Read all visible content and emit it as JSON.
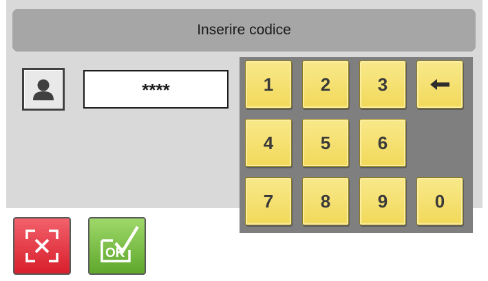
{
  "header": {
    "title": "Inserire codice"
  },
  "code_field": {
    "value": "****"
  },
  "keypad": {
    "keys": [
      {
        "label": "1",
        "row": 0,
        "col": 0
      },
      {
        "label": "2",
        "row": 0,
        "col": 1
      },
      {
        "label": "3",
        "row": 0,
        "col": 2
      },
      {
        "label": "←",
        "row": 0,
        "col": 3,
        "icon": "backspace-arrow-icon"
      },
      {
        "label": "4",
        "row": 1,
        "col": 0
      },
      {
        "label": "5",
        "row": 1,
        "col": 1
      },
      {
        "label": "6",
        "row": 1,
        "col": 2
      },
      {
        "label": "7",
        "row": 2,
        "col": 0
      },
      {
        "label": "8",
        "row": 2,
        "col": 1
      },
      {
        "label": "9",
        "row": 2,
        "col": 2
      },
      {
        "label": "0",
        "row": 2,
        "col": 3
      }
    ]
  },
  "buttons": {
    "cancel_icon": "cancel-x-icon",
    "ok_label": "OK",
    "ok_icon": "ok-check-icon"
  },
  "colors": {
    "key_fill": "#f2d95a",
    "keypad_bg": "#7f7f7f",
    "cancel": "#d81e2c",
    "ok": "#5ea82c"
  }
}
